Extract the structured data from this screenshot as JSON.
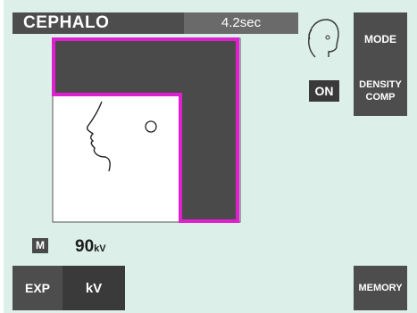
{
  "header": {
    "mode_title": "CEPHALO",
    "exposure_time": "4.2sec"
  },
  "buttons": {
    "mode": "MODE",
    "density_line1": "DENSITY",
    "density_line2": "COMP",
    "exp": "EXP",
    "kv": "kV",
    "memory": "MEMORY"
  },
  "density_status": "ON",
  "readout": {
    "manual_indicator": "M",
    "kv_value": "90",
    "kv_unit": "kV"
  },
  "colors": {
    "screen_bg": "#dcefe8",
    "button_bg": "#4d4d4d",
    "shield_fill": "#4a4a4a",
    "shield_outline": "#e020d0"
  },
  "icons": {
    "head": "head-profile-icon"
  }
}
